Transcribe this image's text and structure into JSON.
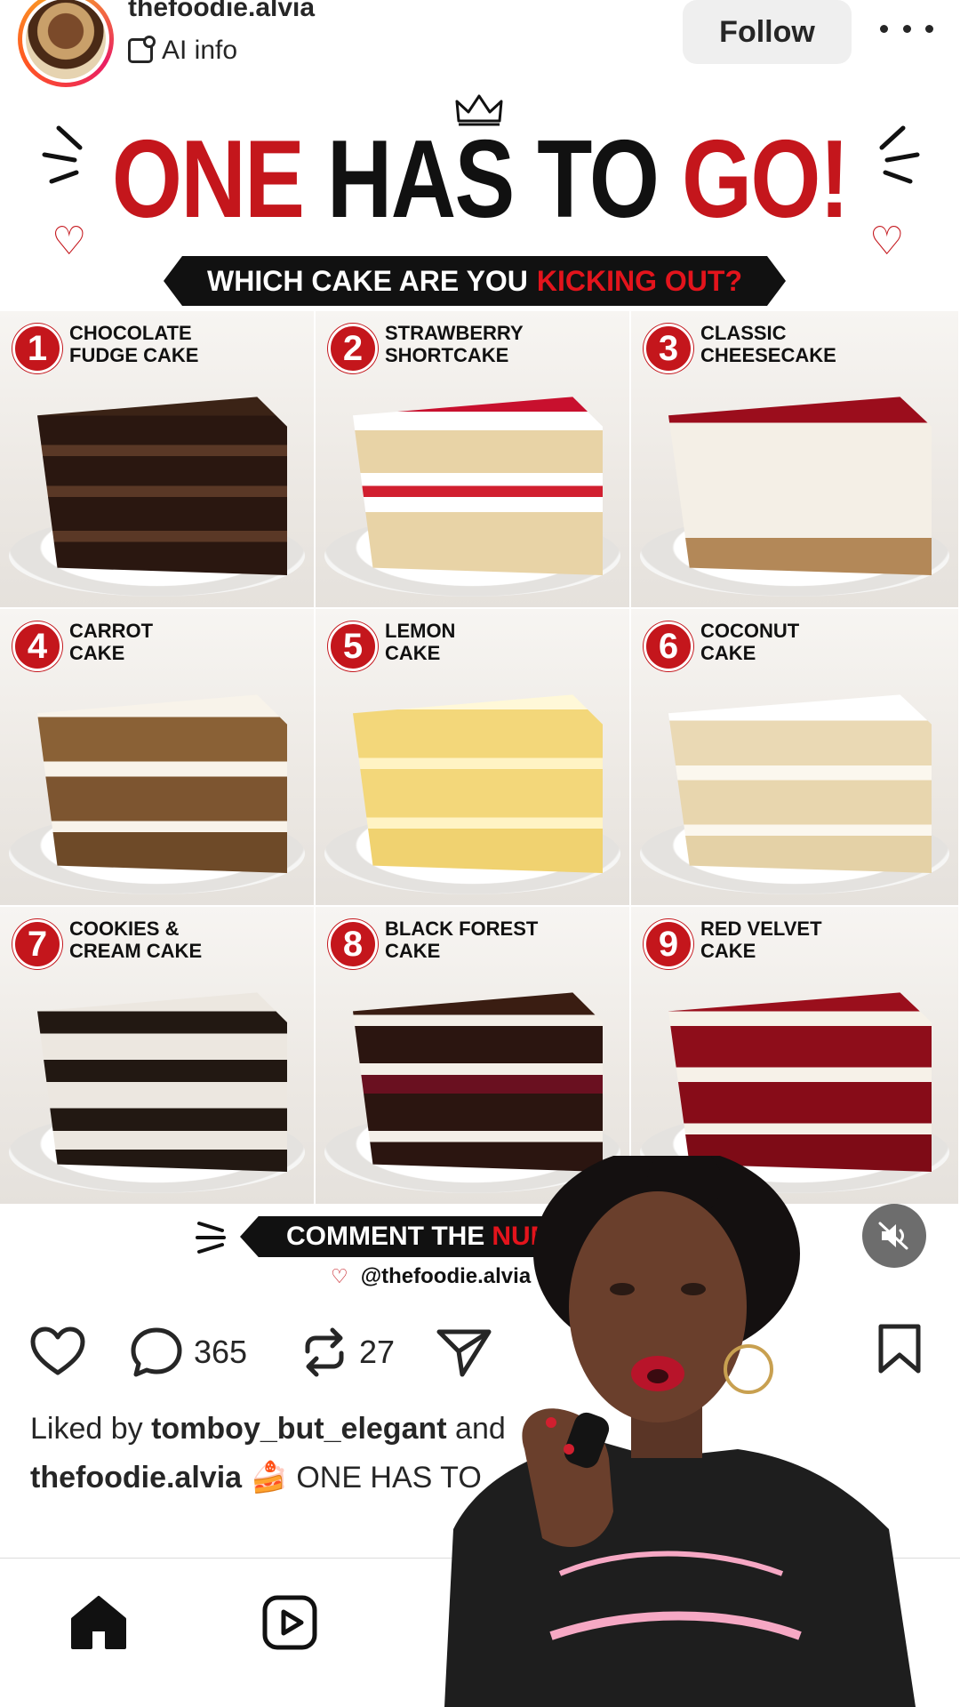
{
  "header": {
    "username": "thefoodie.alvia",
    "ai_label": "AI info",
    "follow_label": "Follow"
  },
  "post": {
    "title_part1": "ONE",
    "title_part2": "HAS TO",
    "title_part3": "GO!",
    "subtitle_white": "WHICH CAKE ARE YOU",
    "subtitle_red": "KICKING OUT?",
    "cakes": [
      {
        "num": "1",
        "name": "CHOCOLATE\nFUDGE CAKE"
      },
      {
        "num": "2",
        "name": "STRAWBERRY\nSHORTCAKE"
      },
      {
        "num": "3",
        "name": "CLASSIC\nCHEESECAKE"
      },
      {
        "num": "4",
        "name": "CARROT\nCAKE"
      },
      {
        "num": "5",
        "name": "LEMON\nCAKE"
      },
      {
        "num": "6",
        "name": "COCONUT\nCAKE"
      },
      {
        "num": "7",
        "name": "COOKIES &\nCREAM CAKE"
      },
      {
        "num": "8",
        "name": "BLACK FOREST\nCAKE"
      },
      {
        "num": "9",
        "name": "RED VELVET\nCAKE"
      }
    ],
    "comment_white": "COMMENT THE",
    "comment_red": "NUMB",
    "handle": "@thefoodie.alvia"
  },
  "actions": {
    "comments_count": "365",
    "reposts_count": "27"
  },
  "likes": {
    "prefix": "Liked by",
    "user": "tomboy_but_elegant",
    "suffix": "and"
  },
  "caption": {
    "user": "thefoodie.alvia",
    "emoji": "🍰",
    "text": "ONE HAS TO"
  },
  "colors": {
    "accent_red": "#c4161c",
    "text_dark": "#262626"
  },
  "icons": [
    "ai-info-icon",
    "more-icon",
    "crown-icon",
    "heart-icon",
    "comment-icon",
    "repost-icon",
    "share-icon",
    "bookmark-icon",
    "home-icon",
    "reels-icon",
    "mute-icon"
  ]
}
